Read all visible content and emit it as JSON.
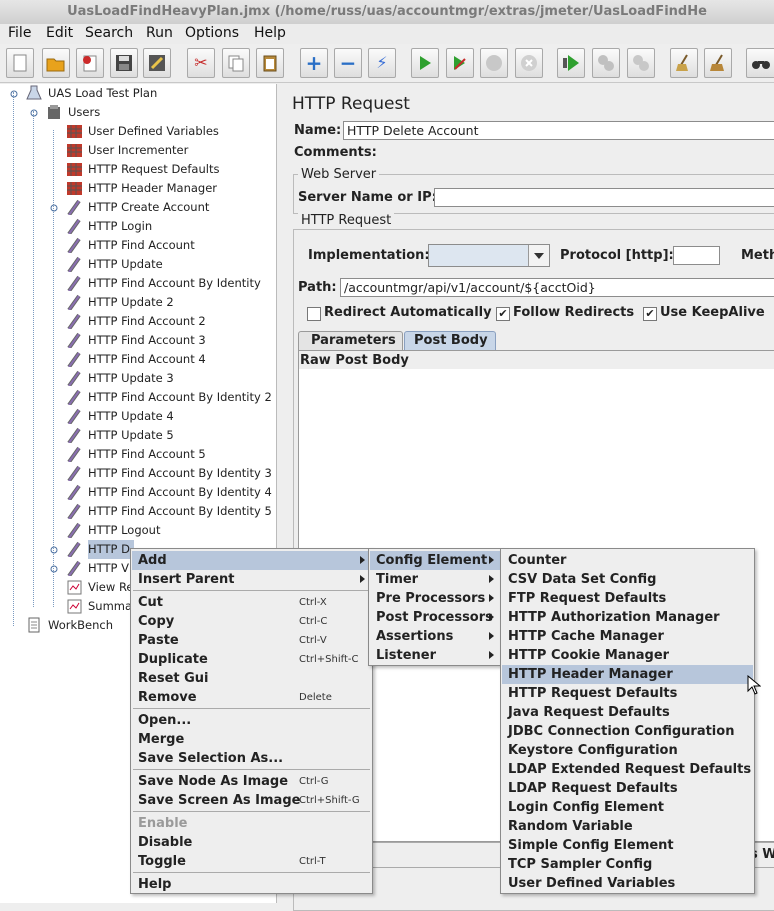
{
  "window": {
    "title": "UasLoadFindHeavyPlan.jmx (/home/russ/uas/accountmgr/extras/jmeter/UasLoadFindHe"
  },
  "menubar": [
    "File",
    "Edit",
    "Search",
    "Run",
    "Options",
    "Help"
  ],
  "tree": {
    "root": "UAS Load Test Plan",
    "group": "Users",
    "items": [
      "User Defined Variables",
      "User Incrementer",
      "HTTP Request Defaults",
      "HTTP Header Manager",
      "HTTP Create Account",
      "HTTP Login",
      "HTTP Find Account",
      "HTTP Update",
      "HTTP Find Account By Identity",
      "HTTP Update 2",
      "HTTP Find Account 2",
      "HTTP Find Account 3",
      "HTTP Find Account 4",
      "HTTP Update 3",
      "HTTP Find Account By Identity 2",
      "HTTP Update 4",
      "HTTP Update 5",
      "HTTP Find Account 5",
      "HTTP Find Account By Identity 3",
      "HTTP Find Account By Identity 4",
      "HTTP Find Account By Identity 5",
      "HTTP Logout",
      "HTTP D",
      "HTTP V",
      "View Re",
      "Summa"
    ],
    "workbench": "WorkBench"
  },
  "panel": {
    "title": "HTTP Request",
    "name_label": "Name:",
    "name_value": "HTTP Delete Account",
    "comments_label": "Comments:",
    "web_server_legend": "Web Server",
    "server_label": "Server Name or IP:",
    "server_value": "",
    "http_request_legend": "HTTP Request",
    "implementation_label": "Implementation:",
    "implementation_value": "",
    "protocol_label": "Protocol [http]:",
    "protocol_value": "",
    "method_label": "Meth",
    "path_label": "Path:",
    "path_value": "/accountmgr/api/v1/account/${acctOid}",
    "redirect_auto": "Redirect Automatically",
    "follow_redirects": "Follow Redirects",
    "use_keepalive": "Use KeepAlive",
    "tabs": [
      "Parameters",
      "Post Body"
    ],
    "raw_post_body_label": "Raw Post Body",
    "bottom_right_fragment": "s W"
  },
  "context_menu": {
    "items": [
      {
        "label": "Add",
        "shortcut": ""
      },
      {
        "label": "Insert Parent",
        "shortcut": ""
      },
      {
        "label": "Cut",
        "shortcut": "Ctrl-X"
      },
      {
        "label": "Copy",
        "shortcut": "Ctrl-C"
      },
      {
        "label": "Paste",
        "shortcut": "Ctrl-V"
      },
      {
        "label": "Duplicate",
        "shortcut": "Ctrl+Shift-C"
      },
      {
        "label": "Reset Gui",
        "shortcut": ""
      },
      {
        "label": "Remove",
        "shortcut": "Delete"
      },
      {
        "label": "Open...",
        "shortcut": ""
      },
      {
        "label": "Merge",
        "shortcut": ""
      },
      {
        "label": "Save Selection As...",
        "shortcut": ""
      },
      {
        "label": "Save Node As Image",
        "shortcut": "Ctrl-G"
      },
      {
        "label": "Save Screen As Image",
        "shortcut": "Ctrl+Shift-G"
      },
      {
        "label": "Enable",
        "shortcut": ""
      },
      {
        "label": "Disable",
        "shortcut": ""
      },
      {
        "label": "Toggle",
        "shortcut": "Ctrl-T"
      },
      {
        "label": "Help",
        "shortcut": ""
      }
    ]
  },
  "add_submenu": [
    "Config Element",
    "Timer",
    "Pre Processors",
    "Post Processors",
    "Assertions",
    "Listener"
  ],
  "config_submenu": [
    "Counter",
    "CSV Data Set Config",
    "FTP Request Defaults",
    "HTTP Authorization Manager",
    "HTTP Cache Manager",
    "HTTP Cookie Manager",
    "HTTP Header Manager",
    "HTTP Request Defaults",
    "Java Request Defaults",
    "JDBC Connection Configuration",
    "Keystore Configuration",
    "LDAP Extended Request Defaults",
    "LDAP Request Defaults",
    "Login Config Element",
    "Random Variable",
    "Simple Config Element",
    "TCP Sampler Config",
    "User Defined Variables"
  ]
}
